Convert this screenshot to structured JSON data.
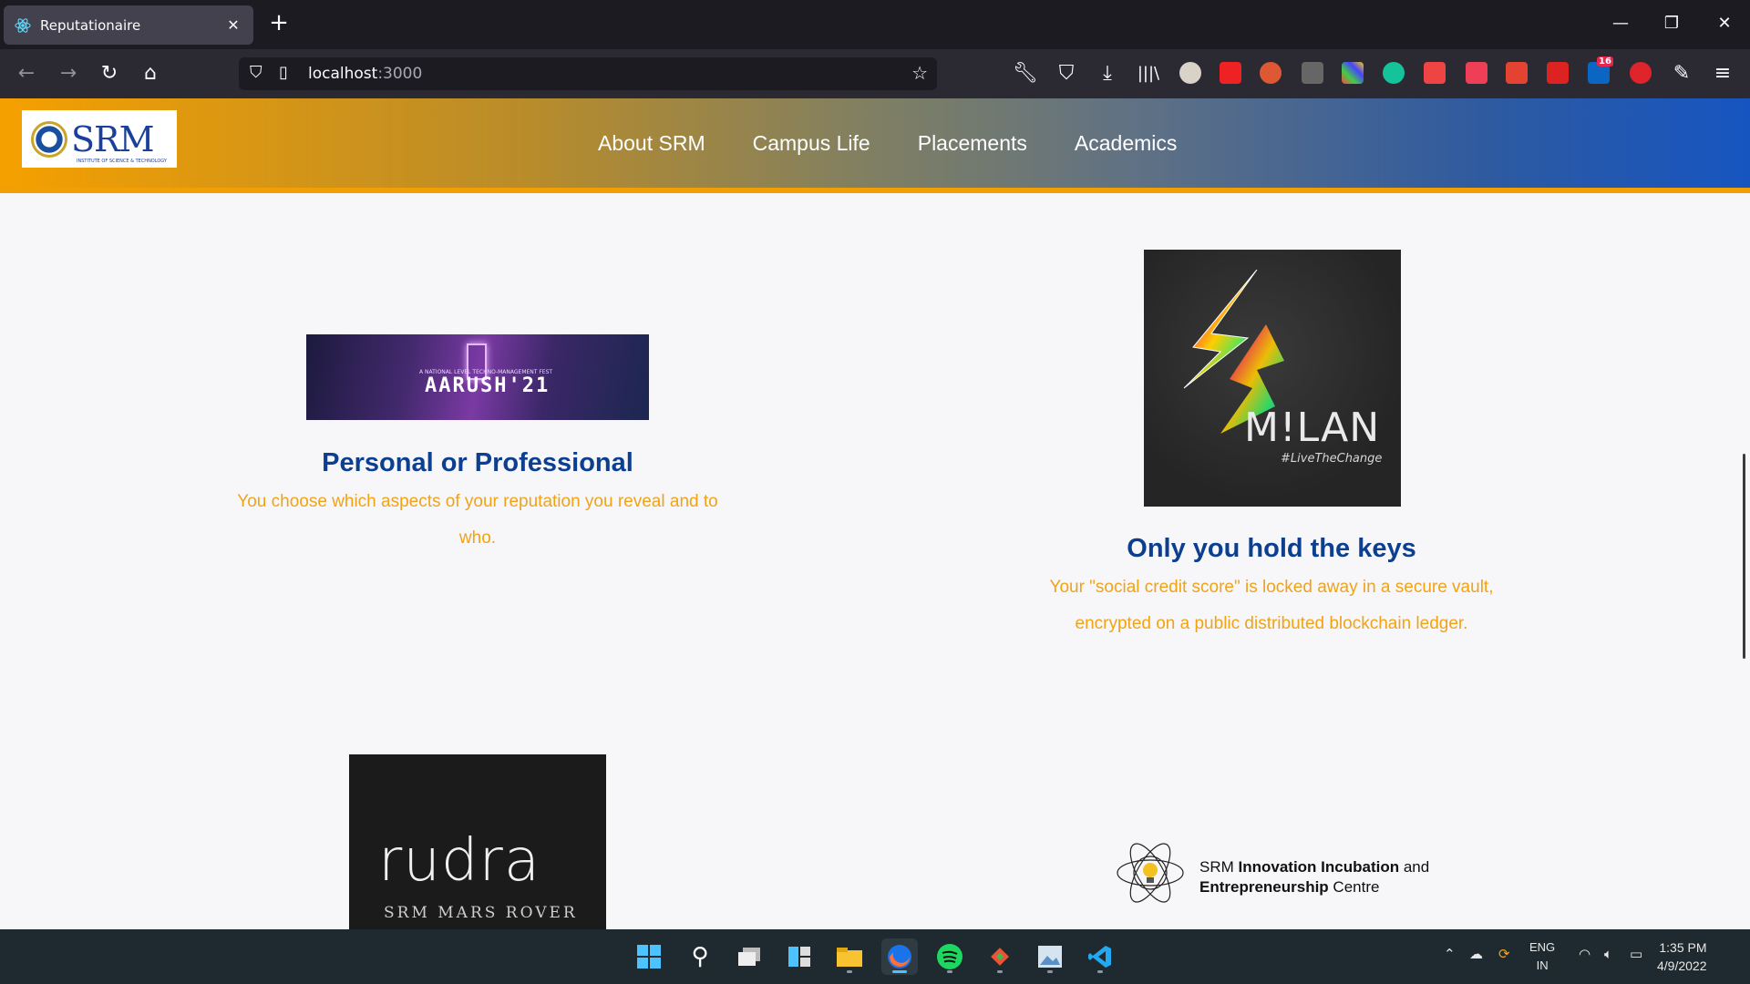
{
  "browser": {
    "tab_title": "Reputationaire",
    "url_host": "localhost",
    "url_port": ":3000",
    "extension_badge": "16"
  },
  "site": {
    "logo_text": "SRM",
    "logo_subtext": "INSTITUTE OF SCIENCE & TECHNOLOGY",
    "nav": [
      "About SRM",
      "Campus Life",
      "Placements",
      "Academics"
    ]
  },
  "features": [
    {
      "image_label": "AARUSH'21",
      "image_tagline": "A NATIONAL LEVEL TECHNO-MANAGEMENT FEST",
      "title": "Personal or Professional",
      "body": "You choose which aspects of your reputation you reveal and to who."
    },
    {
      "image_label": "M!LAN",
      "image_tagline": "#LiveTheChange",
      "title": "Only you hold the keys",
      "body": "Your \"social credit score\" is locked away in a secure vault, encrypted on a public distributed blockchain ledger."
    }
  ],
  "logos": {
    "rudra_word": "rudra",
    "rudra_sub": "SRM MARS ROVER",
    "siic_prefix": "SRM ",
    "siic_bold1": "Innovation Incubation",
    "siic_mid": " and",
    "siic_bold2": "Entrepreneurship",
    "siic_suffix": " Centre"
  },
  "taskbar": {
    "lang_top": "ENG",
    "lang_bottom": "IN",
    "time": "1:35 PM",
    "date": "4/9/2022"
  },
  "colors": {
    "heading": "#0c3f8f",
    "body_text": "#f0a317",
    "header_left": "#f5a000",
    "header_right": "#1655c1"
  }
}
